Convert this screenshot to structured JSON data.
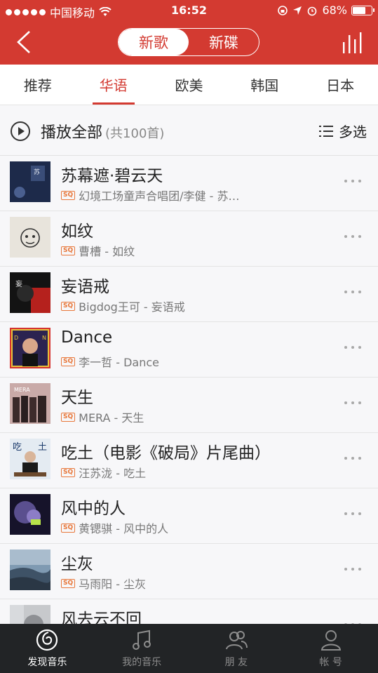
{
  "status_bar": {
    "carrier": "中国移动",
    "time": "16:52",
    "battery": "68%"
  },
  "header": {
    "segments": [
      "新歌",
      "新碟"
    ],
    "active_segment": "新歌"
  },
  "tabs": [
    "推荐",
    "华语",
    "欧美",
    "韩国",
    "日本"
  ],
  "active_tab": "华语",
  "play_all": {
    "label": "播放全部",
    "count": "(共100首)",
    "multi_select": "多选"
  },
  "songs": [
    {
      "title": "苏幕遮·碧云天",
      "artist": "幻境工场童声合唱团/李健 - 苏…",
      "badge": "SQ"
    },
    {
      "title": "如纹",
      "artist": "曹槽 - 如纹",
      "badge": "SQ"
    },
    {
      "title": "妄语戒",
      "artist": "Bigdog王可 - 妄语戒",
      "badge": "SQ"
    },
    {
      "title": "Dance",
      "artist": "李一哲 - Dance",
      "badge": "SQ"
    },
    {
      "title": "天生",
      "artist": "MERA - 天生",
      "badge": "SQ"
    },
    {
      "title": "吃土（电影《破局》片尾曲）",
      "artist": "汪苏泷 - 吃土",
      "badge": "SQ"
    },
    {
      "title": "风中的人",
      "artist": "黄锶骐 - 风中的人",
      "badge": "SQ"
    },
    {
      "title": "尘灰",
      "artist": "马雨阳 - 尘灰",
      "badge": "SQ"
    },
    {
      "title": "风去云不回",
      "artist": "",
      "badge": ""
    }
  ],
  "bottom_nav": [
    {
      "label": "发现音乐",
      "icon": "discover-music-icon",
      "active": true
    },
    {
      "label": "我的音乐",
      "icon": "my-music-icon",
      "active": false
    },
    {
      "label": "朋 友",
      "icon": "friends-icon",
      "active": false
    },
    {
      "label": "帐 号",
      "icon": "account-icon",
      "active": false
    }
  ],
  "colors": {
    "accent": "#d33a31",
    "nav_bg": "#222426",
    "sq_badge": "#e8773a"
  }
}
